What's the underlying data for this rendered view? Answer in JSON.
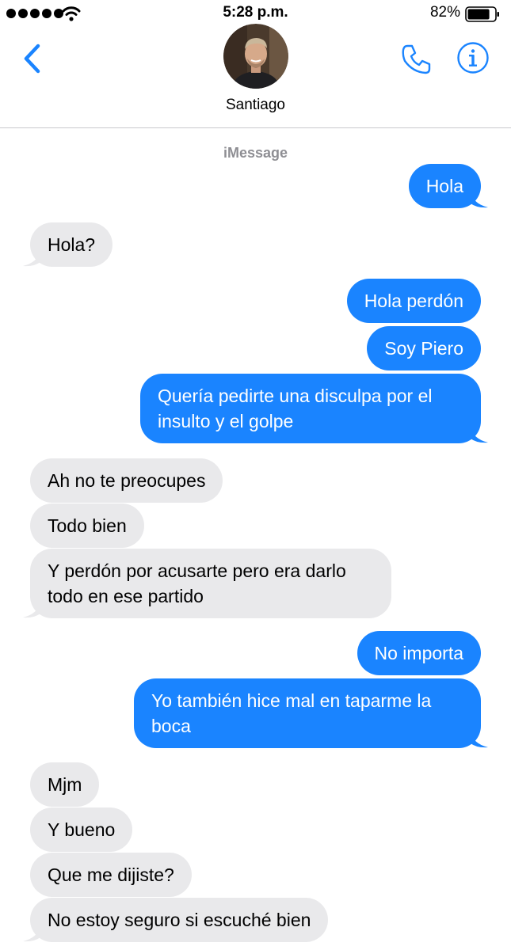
{
  "status_bar": {
    "time": "5:28 p.m.",
    "battery_percent": "82%",
    "battery_level": 0.82,
    "signal_bars": 5,
    "wifi_icon": "wifi-icon"
  },
  "header": {
    "contact_name": "Santiago",
    "back_icon": "chevron-left-icon",
    "call_icon": "phone-icon",
    "info_icon": "info-icon",
    "accent_color": "#1a84ff"
  },
  "service_label": "iMessage",
  "colors": {
    "sent_bubble": "#1a84ff",
    "received_bubble": "#e9e9eb",
    "service_label": "#8e8e93"
  },
  "messages": [
    {
      "dir": "sent",
      "text": "Hola"
    },
    {
      "dir": "received",
      "text": "Hola?"
    },
    {
      "dir": "sent",
      "text": "Hola perdón"
    },
    {
      "dir": "sent",
      "text": "Soy Piero"
    },
    {
      "dir": "sent",
      "text": "Quería pedirte una disculpa por el insulto y el golpe"
    },
    {
      "dir": "received",
      "text": "Ah no te preocupes"
    },
    {
      "dir": "received",
      "text": "Todo bien"
    },
    {
      "dir": "received",
      "text": "Y perdón por acusarte pero era darlo todo en ese partido"
    },
    {
      "dir": "sent",
      "text": "No importa"
    },
    {
      "dir": "sent",
      "text": "Yo también hice mal en taparme la boca"
    },
    {
      "dir": "received",
      "text": "Mjm"
    },
    {
      "dir": "received",
      "text": "Y bueno"
    },
    {
      "dir": "received",
      "text": "Que me dijiste?"
    },
    {
      "dir": "received",
      "text": "No estoy seguro si escuché bien"
    }
  ]
}
